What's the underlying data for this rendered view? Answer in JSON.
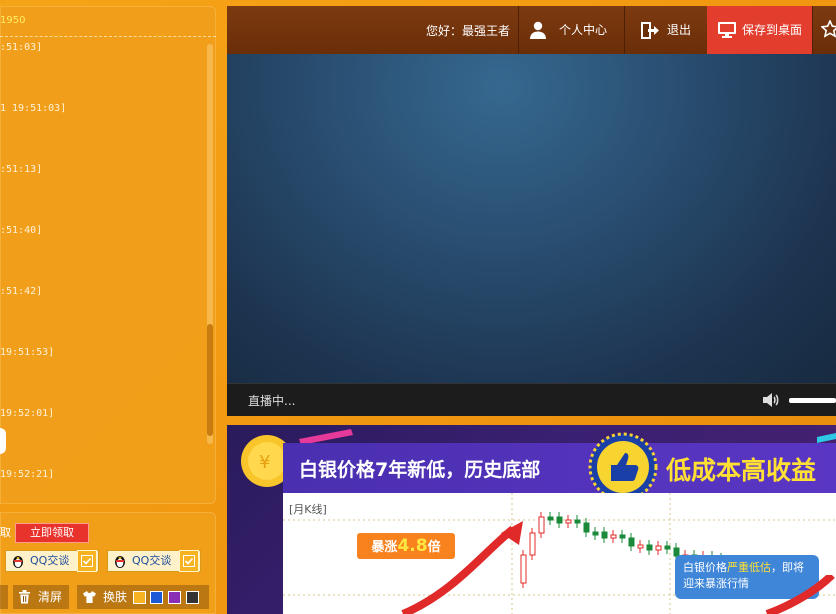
{
  "colors": {
    "accent_red": "#e23d2d",
    "header_brown": "#6a2e08",
    "panel_orange": "#f09e1a",
    "chart_up": "#e02a2a",
    "chart_down": "#1a8a3a"
  },
  "chat": {
    "header_text": "1950",
    "messages": [
      ":51:03]",
      "1 19:51:03]",
      ":51:13]",
      ":51:40]",
      ":51:42]",
      "19:51:53]",
      "19:52:01]",
      "19:52:21]"
    ]
  },
  "tools": {
    "promo_tail": "取",
    "claim_label": "立即领取",
    "qq_label_1": "QQ交谈",
    "qq_label_2": "QQ交谈",
    "clear_label": "清屏",
    "skin_label": "换肤",
    "swatch_colors": [
      "#f7b321",
      "#1d5bd6",
      "#8a2fb5",
      "#333333"
    ]
  },
  "header": {
    "greeting": "您好：最强王者",
    "user_center": "个人中心",
    "logout": "退出",
    "save_desktop": "保存到桌面"
  },
  "player": {
    "status": "直播中...",
    "volume": 0.9
  },
  "ad": {
    "headline": "白银价格7年新低，历史底部",
    "headline2": "低成本高收益",
    "chart_title": "[月K线]",
    "rise_prefix": "暴涨",
    "rise_value": "4.8",
    "rise_suffix": "倍",
    "bubble_pre": "白银价格",
    "bubble_hi": "严重低估",
    "bubble_post": "，即将迎来暴涨行情"
  }
}
